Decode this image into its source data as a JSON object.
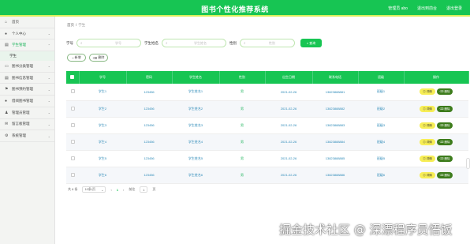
{
  "app": {
    "title": "图书个性化推荐系统",
    "user_label": "管理员 abo",
    "exit_front": "退出到前台",
    "logout": "退出登录"
  },
  "sidebar": {
    "items": [
      {
        "label": "首页",
        "icon": "home-icon"
      },
      {
        "label": "个人中心",
        "icon": "person-icon"
      },
      {
        "label": "学生管理",
        "icon": "book-icon",
        "sub": "学生"
      },
      {
        "label": "图书分类管理",
        "icon": "folder-icon"
      },
      {
        "label": "图书信息管理",
        "icon": "book-icon"
      },
      {
        "label": "图书预约管理",
        "icon": "flag-icon"
      },
      {
        "label": "借阅图书管理",
        "icon": "person-icon"
      },
      {
        "label": "管理员管理",
        "icon": "people-icon"
      },
      {
        "label": "留言板管理",
        "icon": "message-icon"
      },
      {
        "label": "系统管理",
        "icon": "gear-icon"
      }
    ]
  },
  "breadcrumb": {
    "home": "首页",
    "sep": "/",
    "current": "学生"
  },
  "search": {
    "f1_label": "学号",
    "f1_placeholder": "学号",
    "f2_label": "学生姓名",
    "f2_placeholder": "学生姓名",
    "f3_label": "性别",
    "f3_placeholder": "性别",
    "button": "查询"
  },
  "actions": {
    "add": "新增",
    "delete": "删除"
  },
  "table": {
    "headers": [
      "学号",
      "密码",
      "学生姓名",
      "性别",
      "出生日期",
      "联系电话",
      "班级",
      "操作"
    ],
    "rows": [
      [
        "学生1",
        "123456",
        "学生姓名1",
        "男",
        "2021-02-26",
        "13823888881",
        "班级1"
      ],
      [
        "学生2",
        "123456",
        "学生姓名2",
        "男",
        "2021-02-26",
        "13823888882",
        "班级2"
      ],
      [
        "学生3",
        "123456",
        "学生姓名3",
        "男",
        "2021-02-26",
        "13823888883",
        "班级3"
      ],
      [
        "学生4",
        "123456",
        "学生姓名4",
        "男",
        "2021-02-26",
        "13823888884",
        "班级4"
      ],
      [
        "学生5",
        "123456",
        "学生姓名5",
        "男",
        "2021-02-26",
        "13823888885",
        "班级5"
      ],
      [
        "学生6",
        "123456",
        "学生姓名6",
        "男",
        "2021-02-26",
        "13823888886",
        "班级6"
      ]
    ],
    "view_label": "详情",
    "del_label": "删除"
  },
  "pager": {
    "total": "共 6 条",
    "size": "10条/页",
    "page": "1",
    "goto": "前往",
    "goto_val": "1",
    "unit": "页"
  },
  "watermark": "掘金技术社区 @ 深漂程序员悟饭",
  "colors": {
    "primary": "#17c553",
    "accent": "#d9ef5a",
    "view": "#f7ee56",
    "delete": "#3d7c1c"
  }
}
